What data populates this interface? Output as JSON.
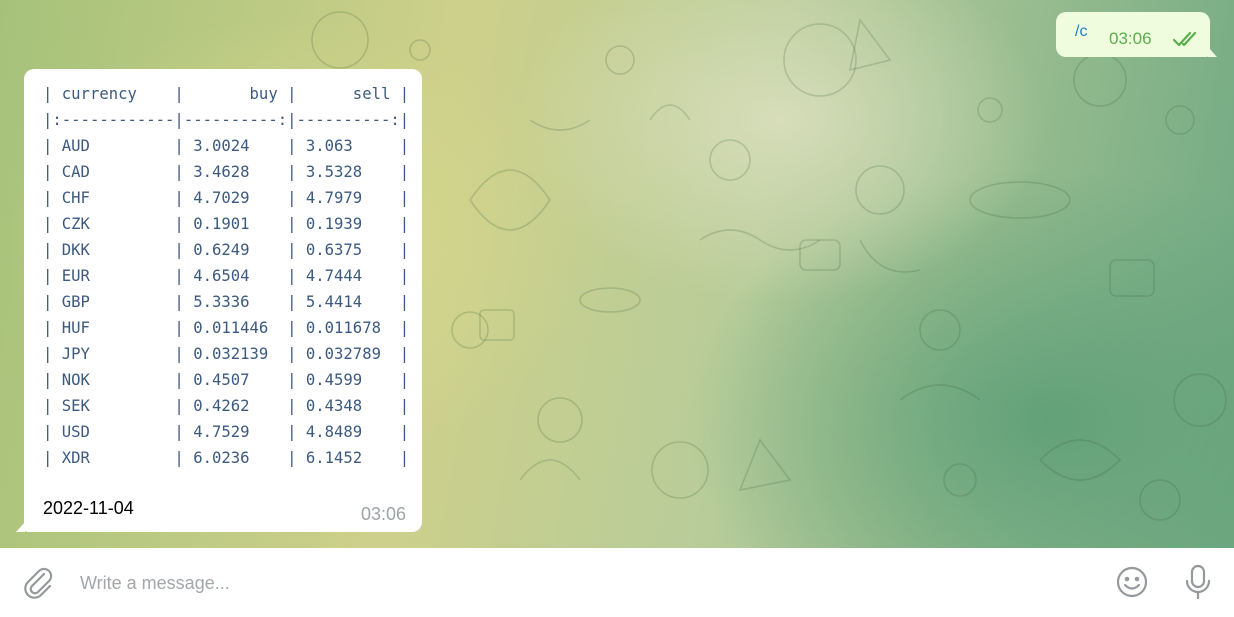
{
  "outgoing": {
    "text": "/c",
    "time": "03:06",
    "status_icon": "double-check-icon"
  },
  "incoming": {
    "table": {
      "header": "| currency    |       buy |      sell |",
      "separator": "|:------------|----------:|----------:|",
      "columns": [
        "currency",
        "buy",
        "sell"
      ],
      "rows": [
        [
          "AUD",
          "3.0024",
          "3.063"
        ],
        [
          "CAD",
          "3.4628",
          "3.5328"
        ],
        [
          "CHF",
          "4.7029",
          "4.7979"
        ],
        [
          "CZK",
          "0.1901",
          "0.1939"
        ],
        [
          "DKK",
          "0.6249",
          "0.6375"
        ],
        [
          "EUR",
          "4.6504",
          "4.7444"
        ],
        [
          "GBP",
          "5.3336",
          "5.4414"
        ],
        [
          "HUF",
          "0.011446",
          "0.011678"
        ],
        [
          "JPY",
          "0.032139",
          "0.032789"
        ],
        [
          "NOK",
          "0.4507",
          "0.4599"
        ],
        [
          "SEK",
          "0.4262",
          "0.4348"
        ],
        [
          "USD",
          "4.7529",
          "4.8489"
        ],
        [
          "XDR",
          "6.0236",
          "6.1452"
        ]
      ]
    },
    "date": "2022-11-04",
    "time": "03:06"
  },
  "composer": {
    "placeholder": "Write a message...",
    "icons": [
      "paperclip-icon",
      "emoji-icon",
      "microphone-icon"
    ]
  },
  "colors": {
    "outgoing_bubble": "#effdde",
    "incoming_bubble": "#ffffff",
    "outgoing_time": "#5aae4e",
    "link": "#2481cc",
    "table_text": "#3c5a80"
  }
}
